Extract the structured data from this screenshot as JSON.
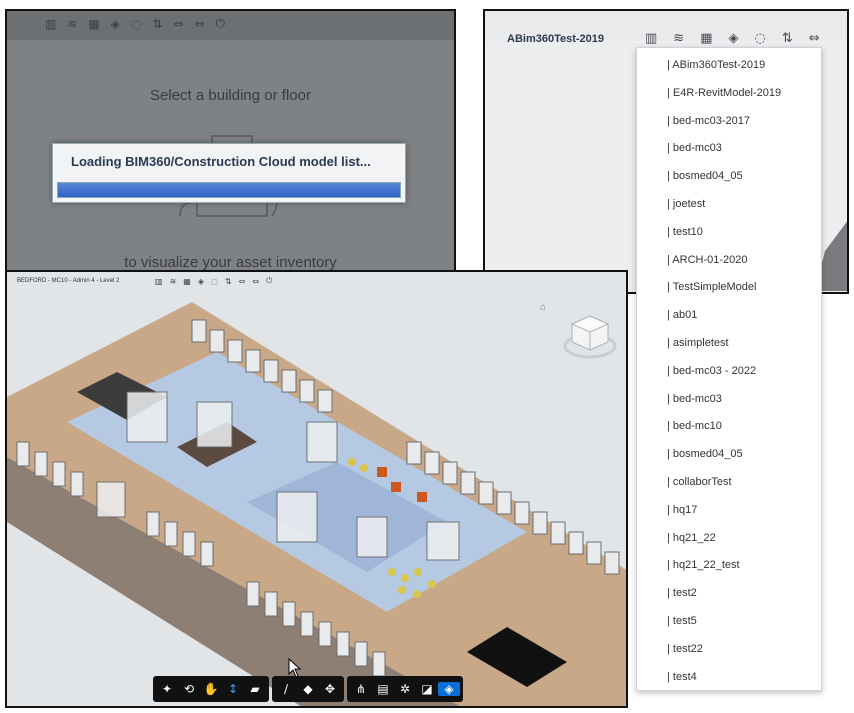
{
  "loading_panel": {
    "toolbar_icons": [
      "building-icon",
      "layers-icon",
      "grid-icon",
      "tag-icon",
      "refresh-icon",
      "sort-icon",
      "move-icon",
      "move-icon",
      "power-icon"
    ],
    "prompt_top": "Select a building or floor",
    "prompt_bottom": "to visualize your asset inventory",
    "dialog_title": "Loading BIM360/Construction Cloud model list...",
    "progress": 1.0
  },
  "model_panel": {
    "current_model": "ABim360Test-2019",
    "toolbar_icons": [
      "building-icon",
      "layers-icon",
      "grid-icon",
      "tag-icon",
      "refresh-icon",
      "sort-icon",
      "move-icon"
    ]
  },
  "dropdown": {
    "items": [
      "| ABim360Test-2019",
      "| E4R-RevitModel-2019",
      "| bed-mc03-2017",
      "| bed-mc03",
      "| bosmed04_05",
      "| joetest",
      "| test10",
      "| ARCH-01-2020",
      "| TestSimpleModel",
      "| ab01",
      "| asimpletest",
      "| bed-mc03 - 2022",
      "| bed-mc03",
      "| bed-mc10",
      "| bosmed04_05",
      "| collaborTest",
      "| hq17",
      "| hq21_22",
      "| hq21_22_test",
      "| test2",
      "| test5",
      "| test22",
      "| test4"
    ]
  },
  "viewer_panel": {
    "header": "BEDFORD - MC10 - Admin 4 - Level 2",
    "toolbar_icons": [
      "building-icon",
      "layers-icon",
      "grid-icon",
      "tag-icon",
      "refresh-icon",
      "sort-icon",
      "move-icon",
      "move-icon",
      "power-icon"
    ],
    "bottom_toolbar": [
      [
        "walk-icon",
        "orbit-icon",
        "pan-icon",
        "zoom-icon",
        "camera-icon"
      ],
      [
        "measure-icon",
        "section-icon",
        "explode-icon"
      ],
      [
        "model-browser-icon",
        "properties-icon",
        "settings-icon",
        "fullscreen-icon",
        "tag-view-icon"
      ]
    ]
  }
}
